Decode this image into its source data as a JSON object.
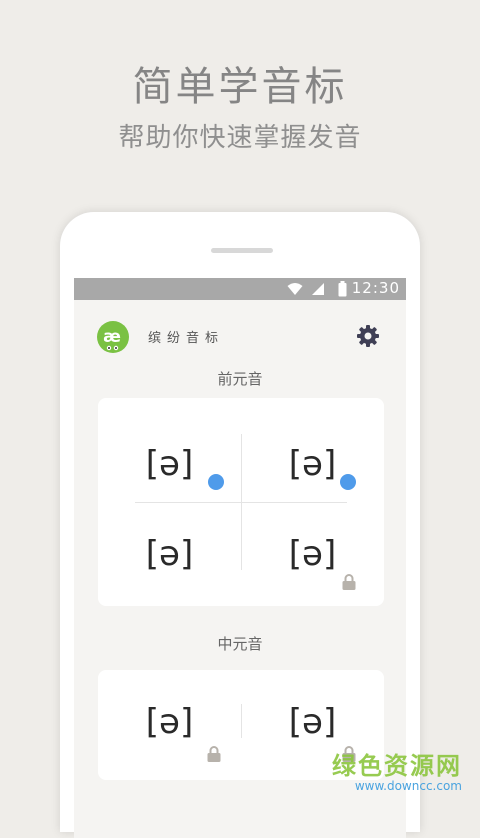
{
  "promo": {
    "headline": "简单学音标",
    "subline": "帮助你快速掌握发音"
  },
  "status_bar": {
    "time": "12:30",
    "icons": [
      "wifi-icon",
      "signal-icon",
      "battery-icon"
    ]
  },
  "app": {
    "logo_text": "æ",
    "title": "缤纷音标",
    "settings_icon": "gear-icon"
  },
  "sections": [
    {
      "title": "前元音",
      "cells": [
        {
          "symbol": "[ə]",
          "indicator": "blue-dot"
        },
        {
          "symbol": "[ə]",
          "indicator": "blue-dot"
        },
        {
          "symbol": "[ə]",
          "indicator": "none"
        },
        {
          "symbol": "[ə]",
          "indicator": "lock"
        }
      ]
    },
    {
      "title": "中元音",
      "cells": [
        {
          "symbol": "[ə]",
          "indicator": "lock"
        },
        {
          "symbol": "[ə]",
          "indicator": "lock"
        }
      ]
    }
  ],
  "watermark": {
    "title": "绿色资源网",
    "url": "www.downcc.com"
  },
  "colors": {
    "background": "#efede9",
    "accent_dot": "#4f9bea",
    "logo_green": "#7ac143",
    "status_bar": "#a8a8a8"
  }
}
